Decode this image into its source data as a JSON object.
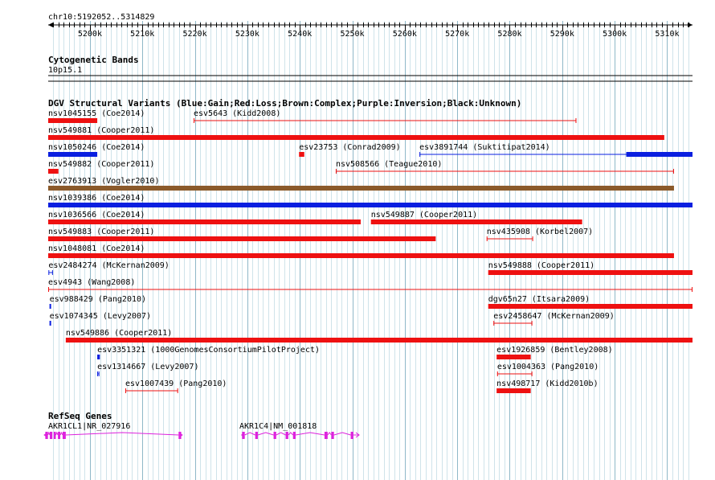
{
  "ruler": {
    "location": "chr10:5192052..5314829",
    "start": 5192052,
    "end": 5314829,
    "tick_labels": [
      "5200k",
      "5210k",
      "5220k",
      "5230k",
      "5240k",
      "5250k",
      "5260k",
      "5270k",
      "5280k",
      "5290k",
      "5300k",
      "5310k"
    ],
    "tick_values": [
      5200000,
      5210000,
      5220000,
      5230000,
      5240000,
      5250000,
      5260000,
      5270000,
      5280000,
      5290000,
      5300000,
      5310000
    ]
  },
  "cytobands": {
    "title": "Cytogenetic Bands",
    "band": "10p15.1"
  },
  "dgv": {
    "title": "DGV Structural Variants (Blue:Gain;Red:Loss;Brown:Complex;Purple:Inversion;Black:Unknown)",
    "colors": {
      "gain": "#0a1fe0",
      "loss": "#ee1111",
      "complex": "#8b5a2b"
    },
    "features": [
      {
        "label": "nsv1045155 (Coe2014)",
        "start": 5192052,
        "end": 5201400,
        "type": "loss",
        "style": "thick"
      },
      {
        "label": "esv5643 (Kidd2008)",
        "start": 5219760,
        "end": 5292700,
        "type": "loss",
        "style": "thin"
      },
      {
        "label": "nsv549881 (Cooper2011)",
        "start": 5192052,
        "end": 5309450,
        "type": "loss",
        "style": "thick"
      },
      {
        "label": "nsv1050246 (Coe2014)",
        "start": 5192052,
        "end": 5201400,
        "type": "gain",
        "style": "thick"
      },
      {
        "label": "esv23753 (Conrad2009)",
        "start": 5239850,
        "end": 5240850,
        "type": "loss",
        "style": "thick"
      },
      {
        "label": "esv3891744 (Suktitipat2014)",
        "start": 5262800,
        "end": 5314829,
        "type": "gain",
        "style": "mixed",
        "thick_from": 5302200
      },
      {
        "label": "nsv549882 (Cooper2011)",
        "start": 5192052,
        "end": 5194000,
        "type": "loss",
        "style": "thick"
      },
      {
        "label": "nsv508566 (Teague2010)",
        "start": 5246850,
        "end": 5311300,
        "type": "loss",
        "style": "thin"
      },
      {
        "label": "esv2763913 (Vogler2010)",
        "start": 5192052,
        "end": 5311300,
        "type": "complex",
        "style": "thick"
      },
      {
        "label": "nsv1039386 (Coe2014)",
        "start": 5192052,
        "end": 5314829,
        "type": "gain",
        "style": "thick"
      },
      {
        "label": "nsv1036566 (Coe2014)",
        "start": 5192052,
        "end": 5251600,
        "type": "loss",
        "style": "thick"
      },
      {
        "label": "nsv549887 (Cooper2011)",
        "start": 5253550,
        "end": 5293800,
        "type": "loss",
        "style": "thick"
      },
      {
        "label": "nsv549883 (Cooper2011)",
        "start": 5192052,
        "end": 5265900,
        "type": "loss",
        "style": "thick"
      },
      {
        "label": "nsv435908 (Korbel2007)",
        "start": 5275600,
        "end": 5284450,
        "type": "loss",
        "style": "thin"
      },
      {
        "label": "nsv1048081 (Coe2014)",
        "start": 5192052,
        "end": 5311300,
        "type": "loss",
        "style": "thick"
      },
      {
        "label": "esv2484274 (McKernan2009)",
        "start": 5192100,
        "end": 5192950,
        "type": "gain",
        "style": "thin"
      },
      {
        "label": "nsv549888 (Cooper2011)",
        "start": 5275900,
        "end": 5314829,
        "type": "loss",
        "style": "thick"
      },
      {
        "label": "esv4943 (Wang2008)",
        "start": 5192052,
        "end": 5314829,
        "type": "loss",
        "style": "thin"
      },
      {
        "label": "esv988429 (Pang2010)",
        "start": 5192300,
        "end": 5192600,
        "type": "gain",
        "style": "thick"
      },
      {
        "label": "dgv65n27 (Itsara2009)",
        "start": 5275900,
        "end": 5314829,
        "type": "loss",
        "style": "thick"
      },
      {
        "label": "esv1074345 (Levy2007)",
        "start": 5192300,
        "end": 5192600,
        "type": "gain",
        "style": "thick"
      },
      {
        "label": "esv2458647 (McKernan2009)",
        "start": 5276900,
        "end": 5284300,
        "type": "loss",
        "style": "thin"
      },
      {
        "label": "nsv549886 (Cooper2011)",
        "start": 5195400,
        "end": 5314829,
        "type": "loss",
        "style": "thick"
      },
      {
        "label": "esv3351321 (1000GenomesConsortiumPilotProject)",
        "start": 5201400,
        "end": 5201900,
        "type": "gain",
        "style": "thick"
      },
      {
        "label": "esv1926859 (Bentley2008)",
        "start": 5277500,
        "end": 5284000,
        "type": "loss",
        "style": "thick"
      },
      {
        "label": "esv1314667 (Levy2007)",
        "start": 5201400,
        "end": 5201800,
        "type": "gain",
        "style": "thin"
      },
      {
        "label": "esv1004363 (Pang2010)",
        "start": 5277600,
        "end": 5284300,
        "type": "loss",
        "style": "thin"
      },
      {
        "label": "esv1007439 (Pang2010)",
        "start": 5206750,
        "end": 5216800,
        "type": "loss",
        "style": "thin"
      },
      {
        "label": "nsv498717 (Kidd2010b)",
        "start": 5277500,
        "end": 5284000,
        "type": "loss",
        "style": "thick"
      }
    ]
  },
  "refseq": {
    "title": "RefSeq Genes",
    "color": "#dd22dd",
    "genes": [
      {
        "label": "AKR1CL1|NR_027916",
        "start": 5191300,
        "end": 5217600,
        "exons": [
          [
            5191500,
            5192000
          ],
          [
            5192350,
            5192850
          ],
          [
            5193100,
            5193500
          ],
          [
            5193900,
            5194350
          ],
          [
            5194800,
            5195400
          ],
          [
            5216900,
            5217400
          ]
        ]
      },
      {
        "label": "AKR1C4|NM_001818",
        "start": 5228900,
        "end": 5251300,
        "exons": [
          [
            5229000,
            5229500
          ],
          [
            5231500,
            5232000
          ],
          [
            5235000,
            5235500
          ],
          [
            5237300,
            5237800
          ],
          [
            5238700,
            5239200
          ],
          [
            5244700,
            5245300
          ],
          [
            5246000,
            5246500
          ],
          [
            5249700,
            5250200
          ]
        ]
      }
    ]
  }
}
